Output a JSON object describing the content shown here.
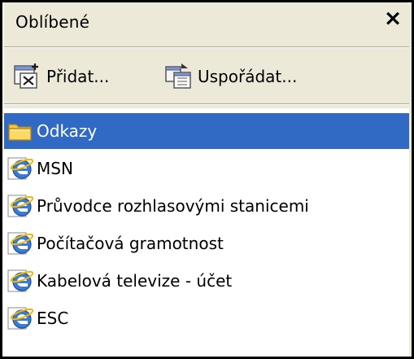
{
  "panel": {
    "title": "Oblíbené",
    "close_label": "×"
  },
  "toolbar": {
    "add_label": "Přidat...",
    "organize_label": "Uspořádat..."
  },
  "favorites": {
    "items": [
      {
        "label": "Odkazy",
        "icon": "folder-icon",
        "selected": true
      },
      {
        "label": "MSN",
        "icon": "ie-link-icon",
        "selected": false
      },
      {
        "label": "Průvodce rozhlasovými stanicemi",
        "icon": "ie-link-icon",
        "selected": false
      },
      {
        "label": "Počítačová gramotnost",
        "icon": "ie-link-icon",
        "selected": false
      },
      {
        "label": "Kabelová televize - účet",
        "icon": "ie-link-icon",
        "selected": false
      },
      {
        "label": "ESC",
        "icon": "ie-link-icon",
        "selected": false
      }
    ]
  },
  "colors": {
    "selection": "#316ac5",
    "panel_bg": "#ece9d8",
    "list_bg": "#ffffff"
  }
}
